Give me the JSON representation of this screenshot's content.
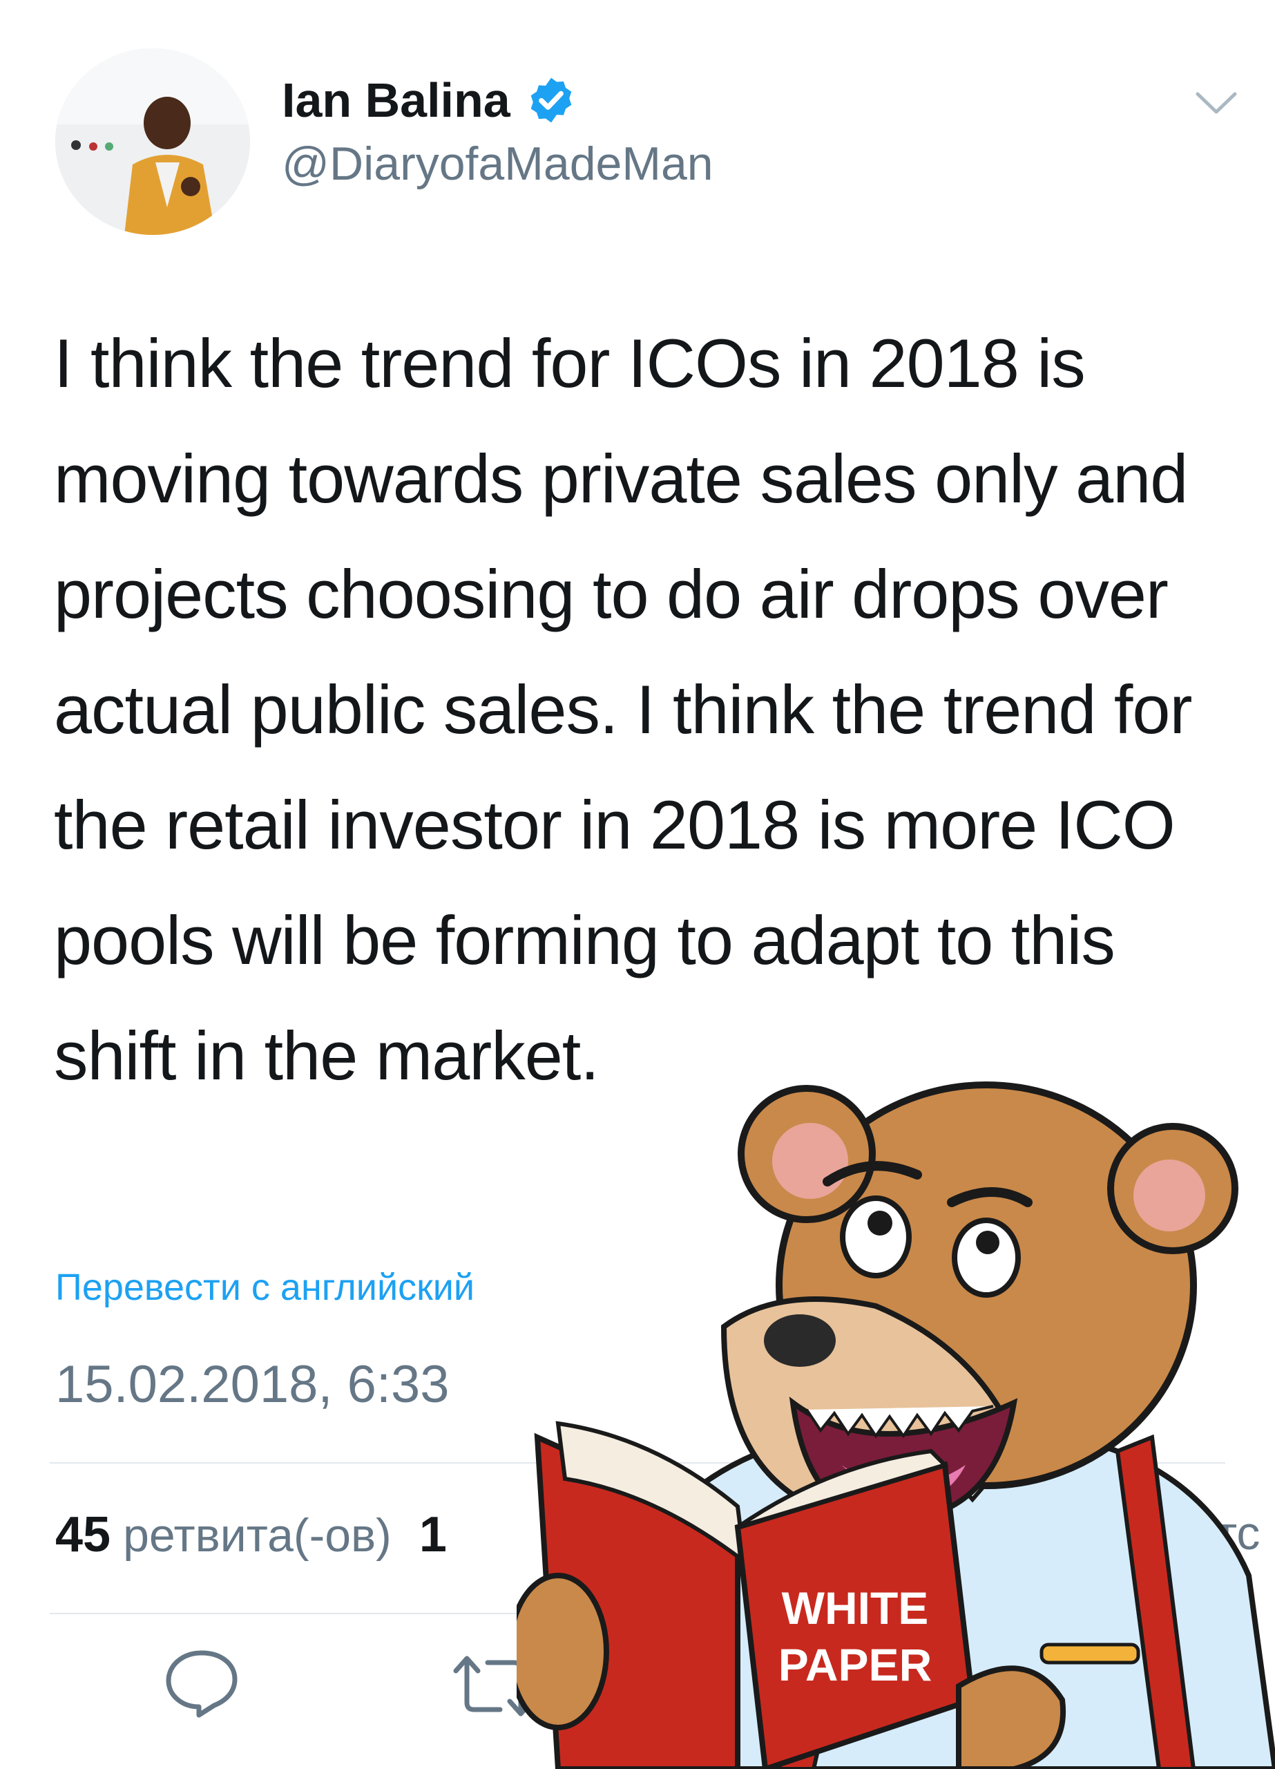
{
  "tweet": {
    "author": {
      "display_name": "Ian Balina",
      "handle": "@DiaryofaMadeMan",
      "verified": true
    },
    "text": "I think the trend for ICOs in 2018 is moving towards private sales only and projects choosing to do air drops over actual public sales. I think the trend for the retail investor in 2018 is more ICO pools will be forming to adapt to this shift in the market.",
    "translate_label": "Перевести с английский",
    "timestamp": "15.02.2018, 6:33",
    "stats": {
      "retweets_count": "45",
      "retweets_label": "ретвита(-ов)",
      "likes_count": "1",
      "likes_label": "тс"
    }
  },
  "sticker": {
    "book_title_line1": "WHITE",
    "book_title_line2": "PAPER"
  },
  "icons": {
    "verified": "verified-badge-icon",
    "menu": "chevron-down-icon",
    "reply": "reply-icon",
    "retweet": "retweet-icon"
  },
  "colors": {
    "accent": "#1da1f2",
    "secondary_text": "#657786",
    "primary_text": "#14171a",
    "divider": "#e1e8ed"
  }
}
